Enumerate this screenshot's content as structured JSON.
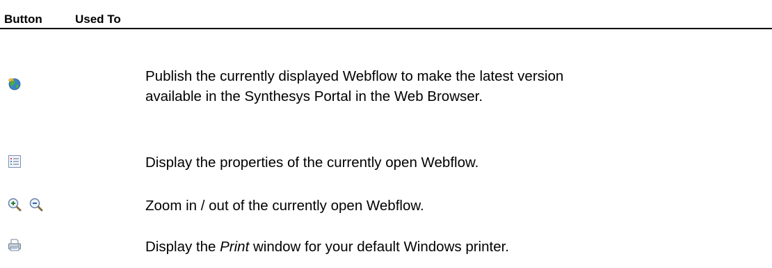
{
  "header": {
    "button_label": "Button",
    "used_to_label": "Used To"
  },
  "rows": [
    {
      "icons": [
        "publish-globe-icon"
      ],
      "text": "Publish the currently displayed Webflow to make the latest version\navailable in the Synthesys Portal in the Web Browser."
    },
    {
      "icons": [
        "properties-list-icon"
      ],
      "text": "Display the properties of the currently open Webflow."
    },
    {
      "icons": [
        "zoom-in-icon",
        "zoom-out-icon"
      ],
      "text": "Zoom in / out of the currently open Webflow."
    },
    {
      "icons": [
        "printer-icon"
      ],
      "text_before": "Display the ",
      "text_italic": "Print",
      "text_after": " window for your default Windows printer."
    }
  ]
}
